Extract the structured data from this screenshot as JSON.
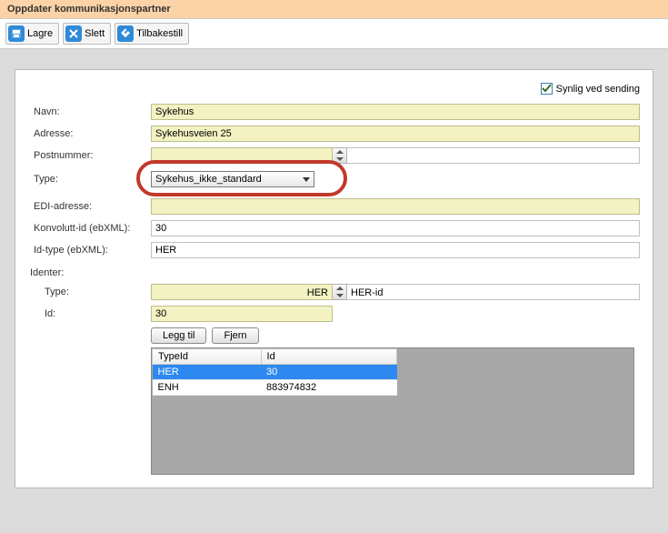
{
  "title": "Oppdater kommunikasjonspartner",
  "toolbar": {
    "save": "Lagre",
    "delete": "Slett",
    "reset": "Tilbakestill"
  },
  "visible_checkbox": {
    "label": "Synlig ved sending",
    "checked": true
  },
  "form": {
    "labels": {
      "navn": "Navn:",
      "adresse": "Adresse:",
      "postnummer": "Postnummer:",
      "type": "Type:",
      "edi": "EDI-adresse:",
      "konvolutt": "Konvolutt-id (ebXML):",
      "idtype": "Id-type (ebXML):"
    },
    "values": {
      "navn": "Sykehus",
      "adresse": "Sykehusveien 25",
      "postnummer_a": "",
      "postnummer_b": "",
      "type": "Sykehus_ikke_standard",
      "edi": "",
      "konvolutt": "30",
      "idtype": "HER"
    }
  },
  "identer": {
    "heading": "Identer:",
    "labels": {
      "type": "Type:",
      "id": "Id:"
    },
    "type_value": "HER",
    "type_desc": "HER-id",
    "id_value": "30",
    "buttons": {
      "add": "Legg til",
      "remove": "Fjern"
    },
    "table": {
      "headers": [
        "TypeId",
        "Id"
      ],
      "rows": [
        {
          "type": "HER",
          "id": "30",
          "selected": true
        },
        {
          "type": "ENH",
          "id": "883974832",
          "selected": false
        }
      ]
    }
  }
}
